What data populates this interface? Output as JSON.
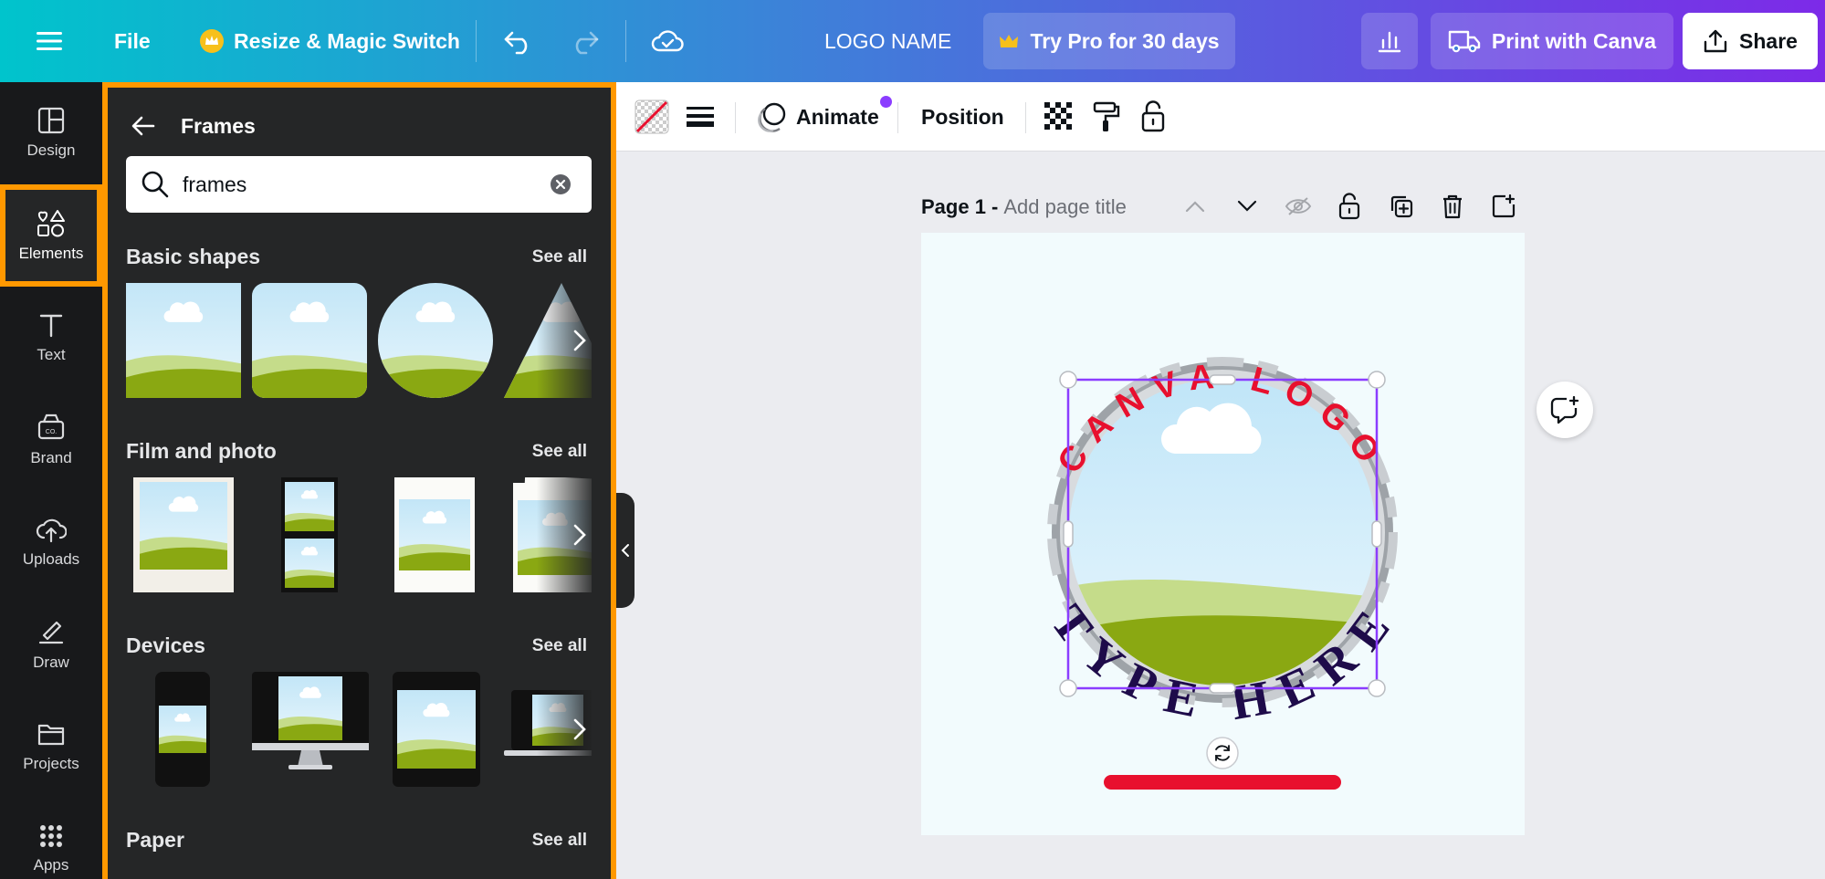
{
  "topbar": {
    "menu_icon": "hamburger-icon",
    "file_label": "File",
    "resize_label": "Resize & Magic Switch",
    "undo_icon": "undo-icon",
    "redo_icon": "redo-icon",
    "cloud_icon": "cloud-check-icon",
    "doc_title": "LOGO NAME",
    "try_pro_label": "Try Pro for 30 days",
    "insights_icon": "bar-chart-icon",
    "print_label": "Print with Canva",
    "share_label": "Share"
  },
  "rail": {
    "items": [
      {
        "label": "Design",
        "icon": "layout-icon"
      },
      {
        "label": "Elements",
        "icon": "shapes-icon"
      },
      {
        "label": "Text",
        "icon": "text-icon"
      },
      {
        "label": "Brand",
        "icon": "brand-icon"
      },
      {
        "label": "Uploads",
        "icon": "cloud-upload-icon"
      },
      {
        "label": "Draw",
        "icon": "pen-icon"
      },
      {
        "label": "Projects",
        "icon": "folder-icon"
      },
      {
        "label": "Apps",
        "icon": "grid-icon"
      }
    ]
  },
  "panel": {
    "title": "Frames",
    "search_value": "frames",
    "sections": [
      {
        "title": "Basic shapes",
        "see_all": "See all"
      },
      {
        "title": "Film and photo",
        "see_all": "See all"
      },
      {
        "title": "Devices",
        "see_all": "See all"
      },
      {
        "title": "Paper",
        "see_all": "See all"
      }
    ]
  },
  "toolbar": {
    "animate_label": "Animate",
    "position_label": "Position"
  },
  "page": {
    "number_label": "Page 1 -",
    "title_placeholder": "Add page title"
  },
  "design": {
    "top_text": "CANVA LOGO",
    "bottom_text": "TYPE HERE"
  },
  "colors": {
    "accent_orange": "#ff9800",
    "selection_purple": "#8b3dff",
    "logo_red": "#e8102e",
    "logo_navy": "#1e0b4a"
  }
}
